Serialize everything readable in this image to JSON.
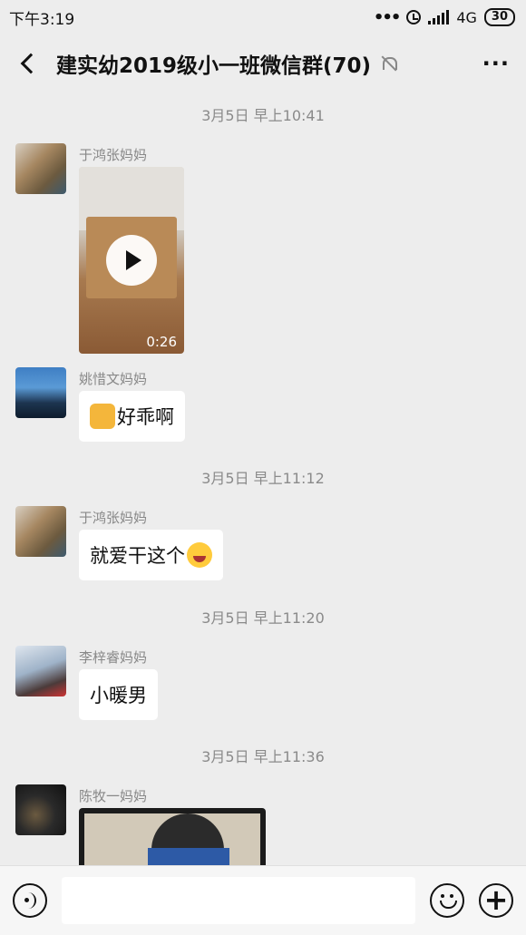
{
  "status_bar": {
    "time": "下午3:19",
    "more": "•••",
    "network": "4G",
    "battery": "30"
  },
  "header": {
    "title": "建实幼2019级小一班微信群(70)",
    "more": "···"
  },
  "messages": [
    {
      "type": "time",
      "text": "3月5日 早上10:41"
    },
    {
      "type": "video",
      "sender": "于鸿张妈妈",
      "duration": "0:26"
    },
    {
      "type": "text",
      "sender": "姚惜文妈妈",
      "emoji": "thumbs-up",
      "text": "好乖啊"
    },
    {
      "type": "time",
      "text": "3月5日 早上11:12"
    },
    {
      "type": "text",
      "sender": "于鸿张妈妈",
      "text": "就爱干这个",
      "emoji": "laugh-cry"
    },
    {
      "type": "time",
      "text": "3月5日 早上11:20"
    },
    {
      "type": "text",
      "sender": "李梓睿妈妈",
      "text": "小暖男"
    },
    {
      "type": "time",
      "text": "3月5日 早上11:36"
    },
    {
      "type": "video",
      "sender": "陈牧一妈妈"
    }
  ],
  "colors": {
    "background": "#ededed",
    "bubble": "#ffffff",
    "timestamp": "#8a8a8a"
  }
}
